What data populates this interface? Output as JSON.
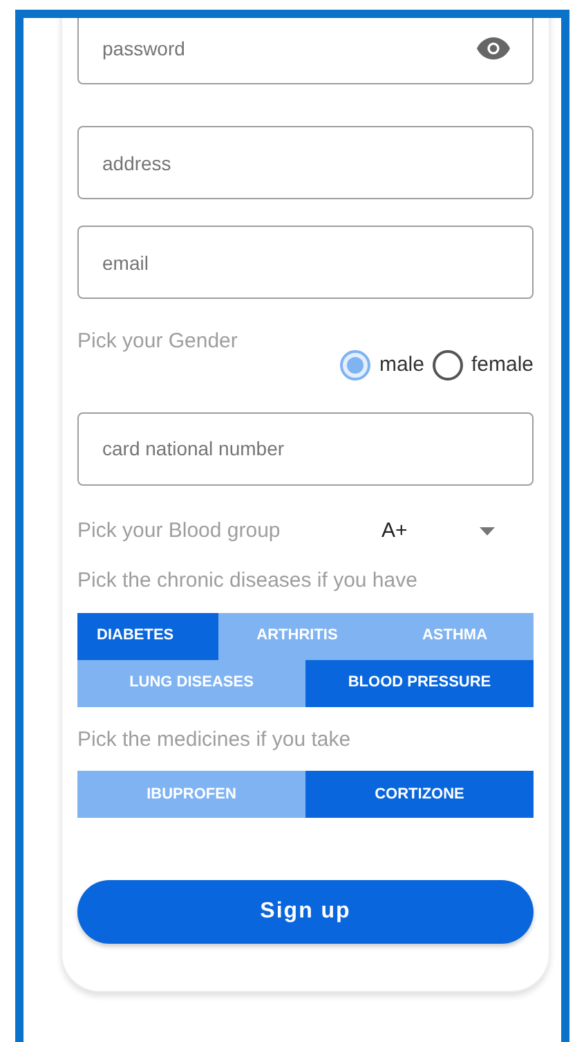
{
  "fields_top": [
    {
      "placeholder": "password",
      "kind": "password"
    },
    {
      "placeholder": "address",
      "kind": "text"
    },
    {
      "placeholder": "email",
      "kind": "text"
    }
  ],
  "gender": {
    "label": "Pick your Gender",
    "options": [
      {
        "label": "male",
        "selected": true
      },
      {
        "label": "female",
        "selected": false
      }
    ]
  },
  "national_number": {
    "placeholder": "card national number"
  },
  "blood_group": {
    "label": "Pick your Blood group",
    "value": "A+"
  },
  "chronic_diseases": {
    "label": "Pick the chronic diseases if you have",
    "rows": [
      {
        "chips": [
          {
            "label": "DIABETES",
            "selected": true
          },
          {
            "label": "ARTHRITIS",
            "selected": false
          },
          {
            "label": "ASTHMA",
            "selected": false
          }
        ]
      },
      {
        "chips": [
          {
            "label": "LUNG DISEASES",
            "selected": false
          },
          {
            "label": "BLOOD PRESSURE",
            "selected": true
          }
        ]
      }
    ]
  },
  "medicines": {
    "label": "Pick the medicines if you take",
    "rows": [
      {
        "chips": [
          {
            "label": "IBUPROFEN",
            "selected": false
          },
          {
            "label": "CORTIZONE",
            "selected": true
          }
        ]
      }
    ]
  },
  "submit": {
    "label": "Sign up"
  }
}
